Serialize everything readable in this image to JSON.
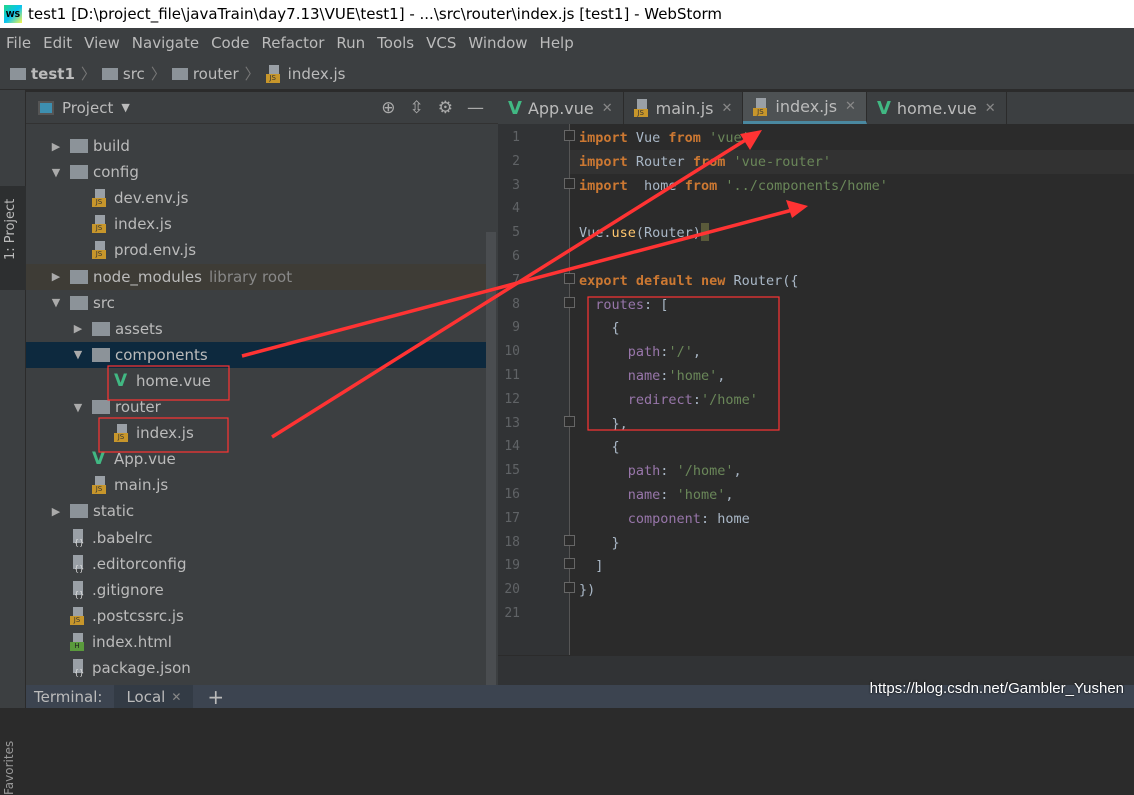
{
  "window": {
    "title": "test1 [D:\\project_file\\javaTrain\\day7.13\\VUE\\test1] - ...\\src\\router\\index.js [test1] - WebStorm",
    "logo": "WS"
  },
  "menu": [
    "File",
    "Edit",
    "View",
    "Navigate",
    "Code",
    "Refactor",
    "Run",
    "Tools",
    "VCS",
    "Window",
    "Help"
  ],
  "breadcrumb": [
    "test1",
    "src",
    "router",
    "index.js"
  ],
  "side": {
    "project_tab": "1: Project",
    "favorites_tab": "Favorites"
  },
  "project": {
    "title": "Project",
    "tree": [
      {
        "label": "build",
        "depth": 0,
        "type": "folder",
        "expanded": false
      },
      {
        "label": "config",
        "depth": 0,
        "type": "folder",
        "expanded": true
      },
      {
        "label": "dev.env.js",
        "depth": 1,
        "type": "js"
      },
      {
        "label": "index.js",
        "depth": 1,
        "type": "js"
      },
      {
        "label": "prod.env.js",
        "depth": 1,
        "type": "js"
      },
      {
        "label": "node_modules",
        "depth": 0,
        "type": "folder",
        "expanded": false,
        "extra": "library root"
      },
      {
        "label": "src",
        "depth": 0,
        "type": "folder",
        "expanded": true
      },
      {
        "label": "assets",
        "depth": 1,
        "type": "folder",
        "expanded": false
      },
      {
        "label": "components",
        "depth": 1,
        "type": "folder",
        "expanded": true,
        "selected": true
      },
      {
        "label": "home.vue",
        "depth": 2,
        "type": "vue"
      },
      {
        "label": "router",
        "depth": 1,
        "type": "folder",
        "expanded": true
      },
      {
        "label": "index.js",
        "depth": 2,
        "type": "js"
      },
      {
        "label": "App.vue",
        "depth": 1,
        "type": "vue"
      },
      {
        "label": "main.js",
        "depth": 1,
        "type": "js"
      },
      {
        "label": "static",
        "depth": 0,
        "type": "folder",
        "expanded": false
      },
      {
        "label": ".babelrc",
        "depth": 0,
        "type": "gen"
      },
      {
        "label": ".editorconfig",
        "depth": 0,
        "type": "gen"
      },
      {
        "label": ".gitignore",
        "depth": 0,
        "type": "gen"
      },
      {
        "label": ".postcssrc.js",
        "depth": 0,
        "type": "js"
      },
      {
        "label": "index.html",
        "depth": 0,
        "type": "html"
      },
      {
        "label": "package.json",
        "depth": 0,
        "type": "gen"
      }
    ]
  },
  "tabs": [
    {
      "label": "App.vue",
      "icon": "vue"
    },
    {
      "label": "main.js",
      "icon": "js"
    },
    {
      "label": "index.js",
      "icon": "js",
      "active": true
    },
    {
      "label": "home.vue",
      "icon": "vue"
    }
  ],
  "code": [
    [
      [
        "import",
        "kw"
      ],
      " Vue ",
      [
        "from",
        "kw"
      ],
      " ",
      [
        "'vue'",
        "st"
      ]
    ],
    [
      [
        "import",
        "kw"
      ],
      " Router ",
      [
        "from",
        "kw"
      ],
      " ",
      [
        "'vue-router'",
        "st"
      ]
    ],
    [
      [
        "import",
        "kw"
      ],
      "  home ",
      [
        "from",
        "kw"
      ],
      " ",
      [
        "'../components/home'",
        "st"
      ]
    ],
    [],
    [
      "Vue.",
      [
        "use",
        "fn"
      ],
      "(Router)"
    ],
    [],
    [
      [
        "export",
        "kw"
      ],
      " ",
      [
        "default",
        "kw"
      ],
      " ",
      [
        "new",
        "kw"
      ],
      " Router({"
    ],
    [
      "  ",
      [
        "routes",
        "pr"
      ],
      ": ["
    ],
    [
      "    {"
    ],
    [
      "      ",
      [
        "path",
        "pr"
      ],
      ":",
      [
        "'/'",
        "st"
      ],
      ","
    ],
    [
      "      ",
      [
        "name",
        "pr"
      ],
      ":",
      [
        "'home'",
        "st"
      ],
      ","
    ],
    [
      "      ",
      [
        "redirect",
        "pr"
      ],
      ":",
      [
        "'/home'",
        "st"
      ]
    ],
    [
      "    },"
    ],
    [
      "    {"
    ],
    [
      "      ",
      [
        "path",
        "pr"
      ],
      ": ",
      [
        "'/home'",
        "st"
      ],
      ","
    ],
    [
      "      ",
      [
        "name",
        "pr"
      ],
      ": ",
      [
        "'home'",
        "st"
      ],
      ","
    ],
    [
      "      ",
      [
        "component",
        "pr"
      ],
      ": home"
    ],
    [
      "    }"
    ],
    [
      "  ]"
    ],
    [
      "})"
    ],
    []
  ],
  "terminal": {
    "label": "Terminal:",
    "session": "Local",
    "add": "+"
  },
  "watermark": "https://blog.csdn.net/Gambler_Yushen",
  "colors": {
    "annotation": "#ff3333",
    "accent": "#4a88a0"
  }
}
